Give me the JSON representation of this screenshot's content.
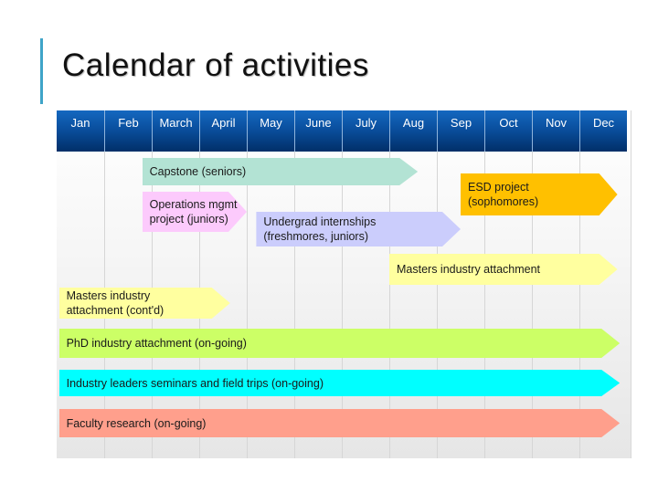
{
  "title": "Calendar of activities",
  "months": [
    "Jan",
    "Feb",
    "March",
    "April",
    "May",
    "June",
    "July",
    "Aug",
    "Sep",
    "Oct",
    "Nov",
    "Dec"
  ],
  "activities": [
    {
      "id": "capstone",
      "label": "Capstone (seniors)",
      "start_month": 1.8,
      "end_month": 7.6,
      "color": "#b3e3d4"
    },
    {
      "id": "esd-project",
      "label": "ESD project\n(sophomores)",
      "start_month": 8.5,
      "end_month": 11.8,
      "color": "#ffc000"
    },
    {
      "id": "operations-mgmt",
      "label": "Operations mgmt\nproject (juniors)",
      "start_month": 1.8,
      "end_month": 4.0,
      "color": "#fccafc"
    },
    {
      "id": "undergrad-internships",
      "label": "Undergrad internships\n(freshmores, juniors)",
      "start_month": 4.2,
      "end_month": 8.5,
      "color": "#cbcdfc"
    },
    {
      "id": "masters-industry",
      "label": "Masters industry attachment",
      "start_month": 7.0,
      "end_month": 11.8,
      "color": "#ffff9f"
    },
    {
      "id": "masters-industry-contd",
      "label": "Masters industry\nattachment (cont'd)",
      "start_month": 0.05,
      "end_month": 3.65,
      "color": "#ffff9f"
    },
    {
      "id": "phd-industry",
      "label": "PhD industry attachment (on-going)",
      "start_month": 0.05,
      "end_month": 11.85,
      "color": "#ccff66"
    },
    {
      "id": "industry-leaders",
      "label": "Industry leaders seminars and field trips (on-going)",
      "start_month": 0.05,
      "end_month": 11.85,
      "color": "#00ffff"
    },
    {
      "id": "faculty-research",
      "label": "Faculty research (on-going)",
      "start_month": 0.05,
      "end_month": 11.85,
      "color": "#ff9f8c"
    }
  ],
  "colors": {
    "accent": "#3fa4c8",
    "header_top": "#1468c0",
    "header_bottom": "#012f68"
  }
}
